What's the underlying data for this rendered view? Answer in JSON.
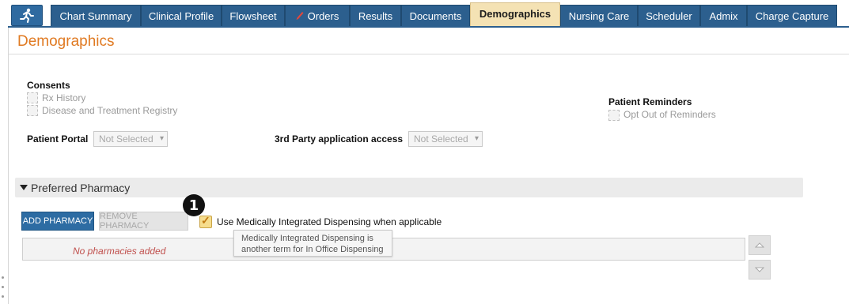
{
  "tabs": [
    {
      "label": "Chart Summary",
      "active": false
    },
    {
      "label": "Clinical Profile",
      "active": false
    },
    {
      "label": "Flowsheet",
      "active": false
    },
    {
      "label": "Orders",
      "active": false,
      "icon": "pencil-icon"
    },
    {
      "label": "Results",
      "active": false
    },
    {
      "label": "Documents",
      "active": false
    },
    {
      "label": "Demographics",
      "active": true
    },
    {
      "label": "Nursing Care",
      "active": false
    },
    {
      "label": "Scheduler",
      "active": false
    },
    {
      "label": "Admix",
      "active": false
    },
    {
      "label": "Charge Capture",
      "active": false
    }
  ],
  "home_icon": "person-running-icon",
  "page": {
    "title": "Demographics"
  },
  "consents": {
    "heading": "Consents",
    "items": [
      {
        "label": "Rx History",
        "checked": false
      },
      {
        "label": "Disease and Treatment Registry",
        "checked": false
      }
    ]
  },
  "reminders": {
    "heading": "Patient Reminders",
    "opt_out_label": "Opt Out of Reminders",
    "checked": false
  },
  "patient_portal": {
    "label": "Patient Portal",
    "value": "Not Selected"
  },
  "third_party": {
    "label": "3rd Party application access",
    "value": "Not Selected"
  },
  "pharmacy": {
    "section_title": "Preferred Pharmacy",
    "add_label": "ADD PHARMACY",
    "remove_label": "REMOVE PHARMACY",
    "badge": "1",
    "mid_label": "Use Medically Integrated Dispensing when applicable",
    "mid_checked": true,
    "tooltip_line1": "Medically Integrated Dispensing is",
    "tooltip_line2": "another term for In Office Dispensing",
    "empty_message": "No pharmacies added"
  },
  "colors": {
    "tab_bg": "#2c5f8e",
    "active_tab_bg": "#f4e2b4",
    "title": "#e07a22",
    "empty_message": "#c0504d",
    "button_primary": "#2d6ca3"
  }
}
